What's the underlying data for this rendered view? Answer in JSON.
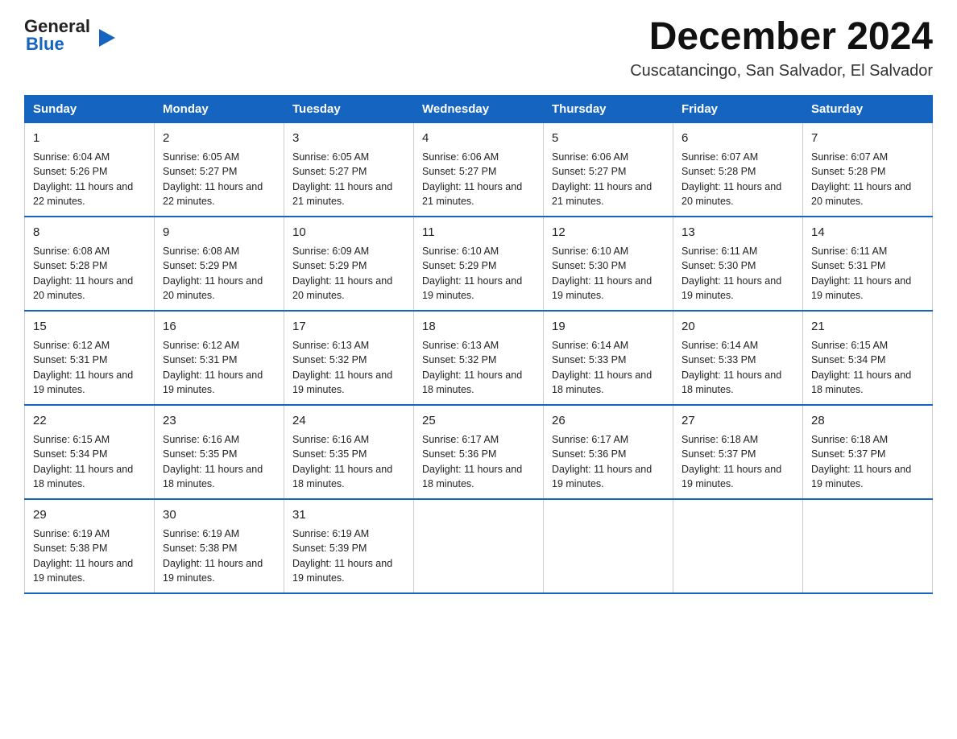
{
  "logo": {
    "general": "General",
    "blue": "Blue",
    "arrow": "▶"
  },
  "title": "December 2024",
  "subtitle": "Cuscatancingo, San Salvador, El Salvador",
  "days_of_week": [
    "Sunday",
    "Monday",
    "Tuesday",
    "Wednesday",
    "Thursday",
    "Friday",
    "Saturday"
  ],
  "weeks": [
    [
      {
        "num": "1",
        "sunrise": "Sunrise: 6:04 AM",
        "sunset": "Sunset: 5:26 PM",
        "daylight": "Daylight: 11 hours and 22 minutes."
      },
      {
        "num": "2",
        "sunrise": "Sunrise: 6:05 AM",
        "sunset": "Sunset: 5:27 PM",
        "daylight": "Daylight: 11 hours and 22 minutes."
      },
      {
        "num": "3",
        "sunrise": "Sunrise: 6:05 AM",
        "sunset": "Sunset: 5:27 PM",
        "daylight": "Daylight: 11 hours and 21 minutes."
      },
      {
        "num": "4",
        "sunrise": "Sunrise: 6:06 AM",
        "sunset": "Sunset: 5:27 PM",
        "daylight": "Daylight: 11 hours and 21 minutes."
      },
      {
        "num": "5",
        "sunrise": "Sunrise: 6:06 AM",
        "sunset": "Sunset: 5:27 PM",
        "daylight": "Daylight: 11 hours and 21 minutes."
      },
      {
        "num": "6",
        "sunrise": "Sunrise: 6:07 AM",
        "sunset": "Sunset: 5:28 PM",
        "daylight": "Daylight: 11 hours and 20 minutes."
      },
      {
        "num": "7",
        "sunrise": "Sunrise: 6:07 AM",
        "sunset": "Sunset: 5:28 PM",
        "daylight": "Daylight: 11 hours and 20 minutes."
      }
    ],
    [
      {
        "num": "8",
        "sunrise": "Sunrise: 6:08 AM",
        "sunset": "Sunset: 5:28 PM",
        "daylight": "Daylight: 11 hours and 20 minutes."
      },
      {
        "num": "9",
        "sunrise": "Sunrise: 6:08 AM",
        "sunset": "Sunset: 5:29 PM",
        "daylight": "Daylight: 11 hours and 20 minutes."
      },
      {
        "num": "10",
        "sunrise": "Sunrise: 6:09 AM",
        "sunset": "Sunset: 5:29 PM",
        "daylight": "Daylight: 11 hours and 20 minutes."
      },
      {
        "num": "11",
        "sunrise": "Sunrise: 6:10 AM",
        "sunset": "Sunset: 5:29 PM",
        "daylight": "Daylight: 11 hours and 19 minutes."
      },
      {
        "num": "12",
        "sunrise": "Sunrise: 6:10 AM",
        "sunset": "Sunset: 5:30 PM",
        "daylight": "Daylight: 11 hours and 19 minutes."
      },
      {
        "num": "13",
        "sunrise": "Sunrise: 6:11 AM",
        "sunset": "Sunset: 5:30 PM",
        "daylight": "Daylight: 11 hours and 19 minutes."
      },
      {
        "num": "14",
        "sunrise": "Sunrise: 6:11 AM",
        "sunset": "Sunset: 5:31 PM",
        "daylight": "Daylight: 11 hours and 19 minutes."
      }
    ],
    [
      {
        "num": "15",
        "sunrise": "Sunrise: 6:12 AM",
        "sunset": "Sunset: 5:31 PM",
        "daylight": "Daylight: 11 hours and 19 minutes."
      },
      {
        "num": "16",
        "sunrise": "Sunrise: 6:12 AM",
        "sunset": "Sunset: 5:31 PM",
        "daylight": "Daylight: 11 hours and 19 minutes."
      },
      {
        "num": "17",
        "sunrise": "Sunrise: 6:13 AM",
        "sunset": "Sunset: 5:32 PM",
        "daylight": "Daylight: 11 hours and 19 minutes."
      },
      {
        "num": "18",
        "sunrise": "Sunrise: 6:13 AM",
        "sunset": "Sunset: 5:32 PM",
        "daylight": "Daylight: 11 hours and 18 minutes."
      },
      {
        "num": "19",
        "sunrise": "Sunrise: 6:14 AM",
        "sunset": "Sunset: 5:33 PM",
        "daylight": "Daylight: 11 hours and 18 minutes."
      },
      {
        "num": "20",
        "sunrise": "Sunrise: 6:14 AM",
        "sunset": "Sunset: 5:33 PM",
        "daylight": "Daylight: 11 hours and 18 minutes."
      },
      {
        "num": "21",
        "sunrise": "Sunrise: 6:15 AM",
        "sunset": "Sunset: 5:34 PM",
        "daylight": "Daylight: 11 hours and 18 minutes."
      }
    ],
    [
      {
        "num": "22",
        "sunrise": "Sunrise: 6:15 AM",
        "sunset": "Sunset: 5:34 PM",
        "daylight": "Daylight: 11 hours and 18 minutes."
      },
      {
        "num": "23",
        "sunrise": "Sunrise: 6:16 AM",
        "sunset": "Sunset: 5:35 PM",
        "daylight": "Daylight: 11 hours and 18 minutes."
      },
      {
        "num": "24",
        "sunrise": "Sunrise: 6:16 AM",
        "sunset": "Sunset: 5:35 PM",
        "daylight": "Daylight: 11 hours and 18 minutes."
      },
      {
        "num": "25",
        "sunrise": "Sunrise: 6:17 AM",
        "sunset": "Sunset: 5:36 PM",
        "daylight": "Daylight: 11 hours and 18 minutes."
      },
      {
        "num": "26",
        "sunrise": "Sunrise: 6:17 AM",
        "sunset": "Sunset: 5:36 PM",
        "daylight": "Daylight: 11 hours and 19 minutes."
      },
      {
        "num": "27",
        "sunrise": "Sunrise: 6:18 AM",
        "sunset": "Sunset: 5:37 PM",
        "daylight": "Daylight: 11 hours and 19 minutes."
      },
      {
        "num": "28",
        "sunrise": "Sunrise: 6:18 AM",
        "sunset": "Sunset: 5:37 PM",
        "daylight": "Daylight: 11 hours and 19 minutes."
      }
    ],
    [
      {
        "num": "29",
        "sunrise": "Sunrise: 6:19 AM",
        "sunset": "Sunset: 5:38 PM",
        "daylight": "Daylight: 11 hours and 19 minutes."
      },
      {
        "num": "30",
        "sunrise": "Sunrise: 6:19 AM",
        "sunset": "Sunset: 5:38 PM",
        "daylight": "Daylight: 11 hours and 19 minutes."
      },
      {
        "num": "31",
        "sunrise": "Sunrise: 6:19 AM",
        "sunset": "Sunset: 5:39 PM",
        "daylight": "Daylight: 11 hours and 19 minutes."
      },
      null,
      null,
      null,
      null
    ]
  ]
}
